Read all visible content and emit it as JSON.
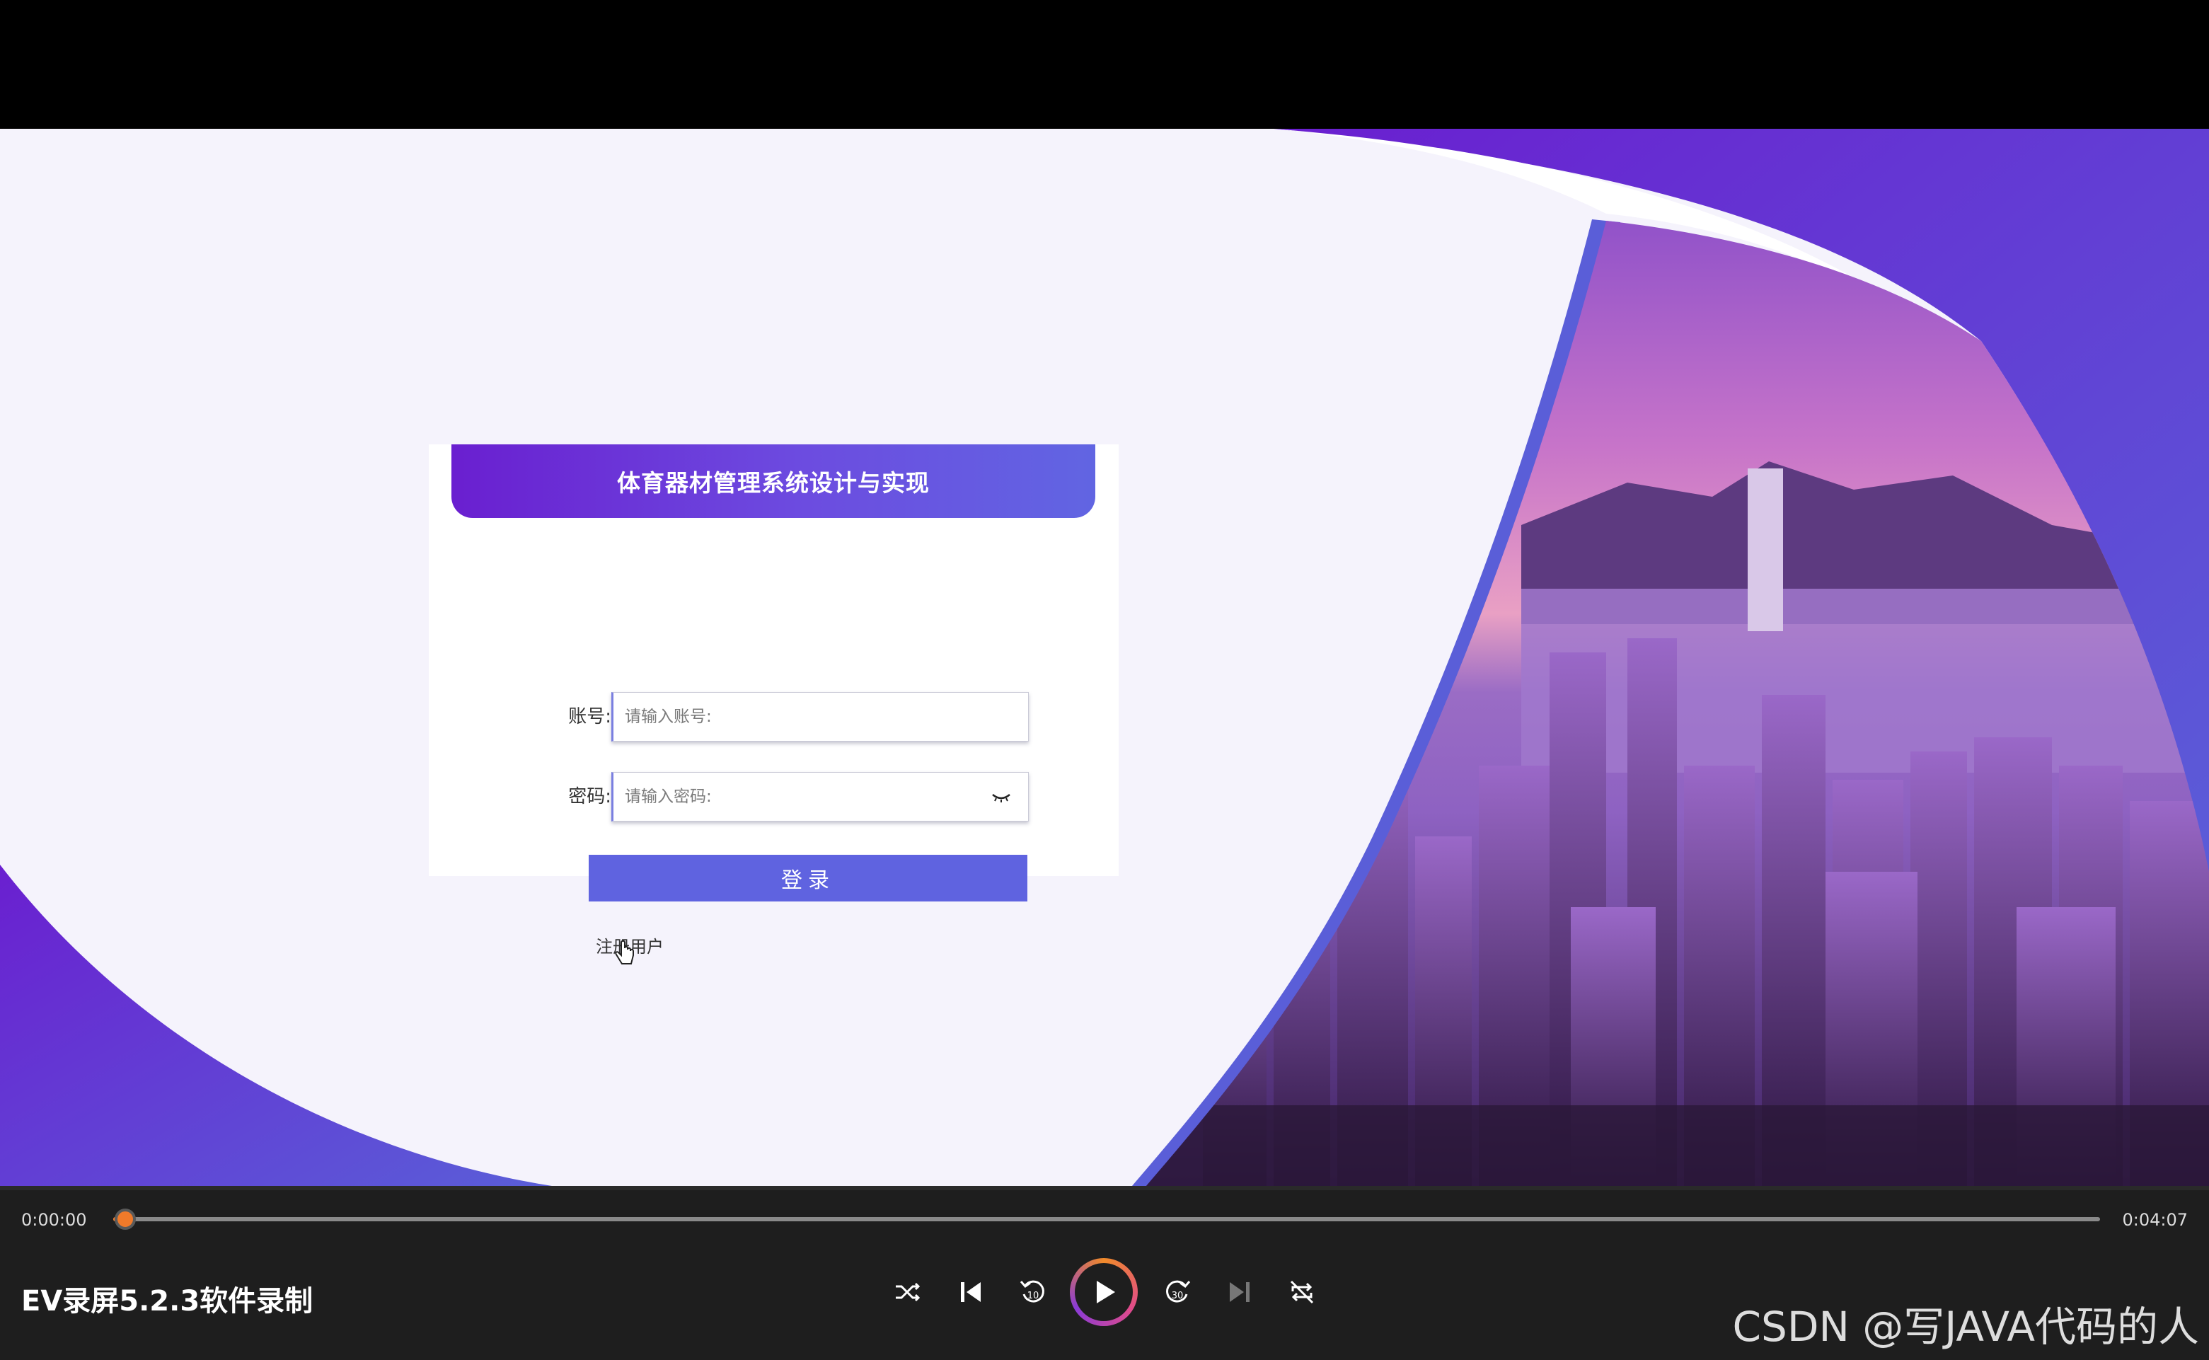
{
  "login": {
    "title": "体育器材管理系统设计与实现",
    "account_label": "账号:",
    "account_placeholder": "请输入账号:",
    "password_label": "密码:",
    "password_placeholder": "请输入密码:",
    "login_button": "登录",
    "register_link": "注册用户"
  },
  "player": {
    "current_time": "0:00:00",
    "total_time": "0:04:07",
    "progress_percent": 0.5,
    "caption": "EV录屏5.2.3软件录制",
    "watermark": "CSDN @写JAVA代码的人",
    "accent_color": "#f07a2a"
  },
  "icons": [
    "shuffle-icon",
    "skip-previous-icon",
    "rewind-10-icon",
    "play-icon",
    "forward-30-icon",
    "skip-next-icon",
    "repeat-icon",
    "eye-closed-icon",
    "hand-cursor-icon"
  ]
}
